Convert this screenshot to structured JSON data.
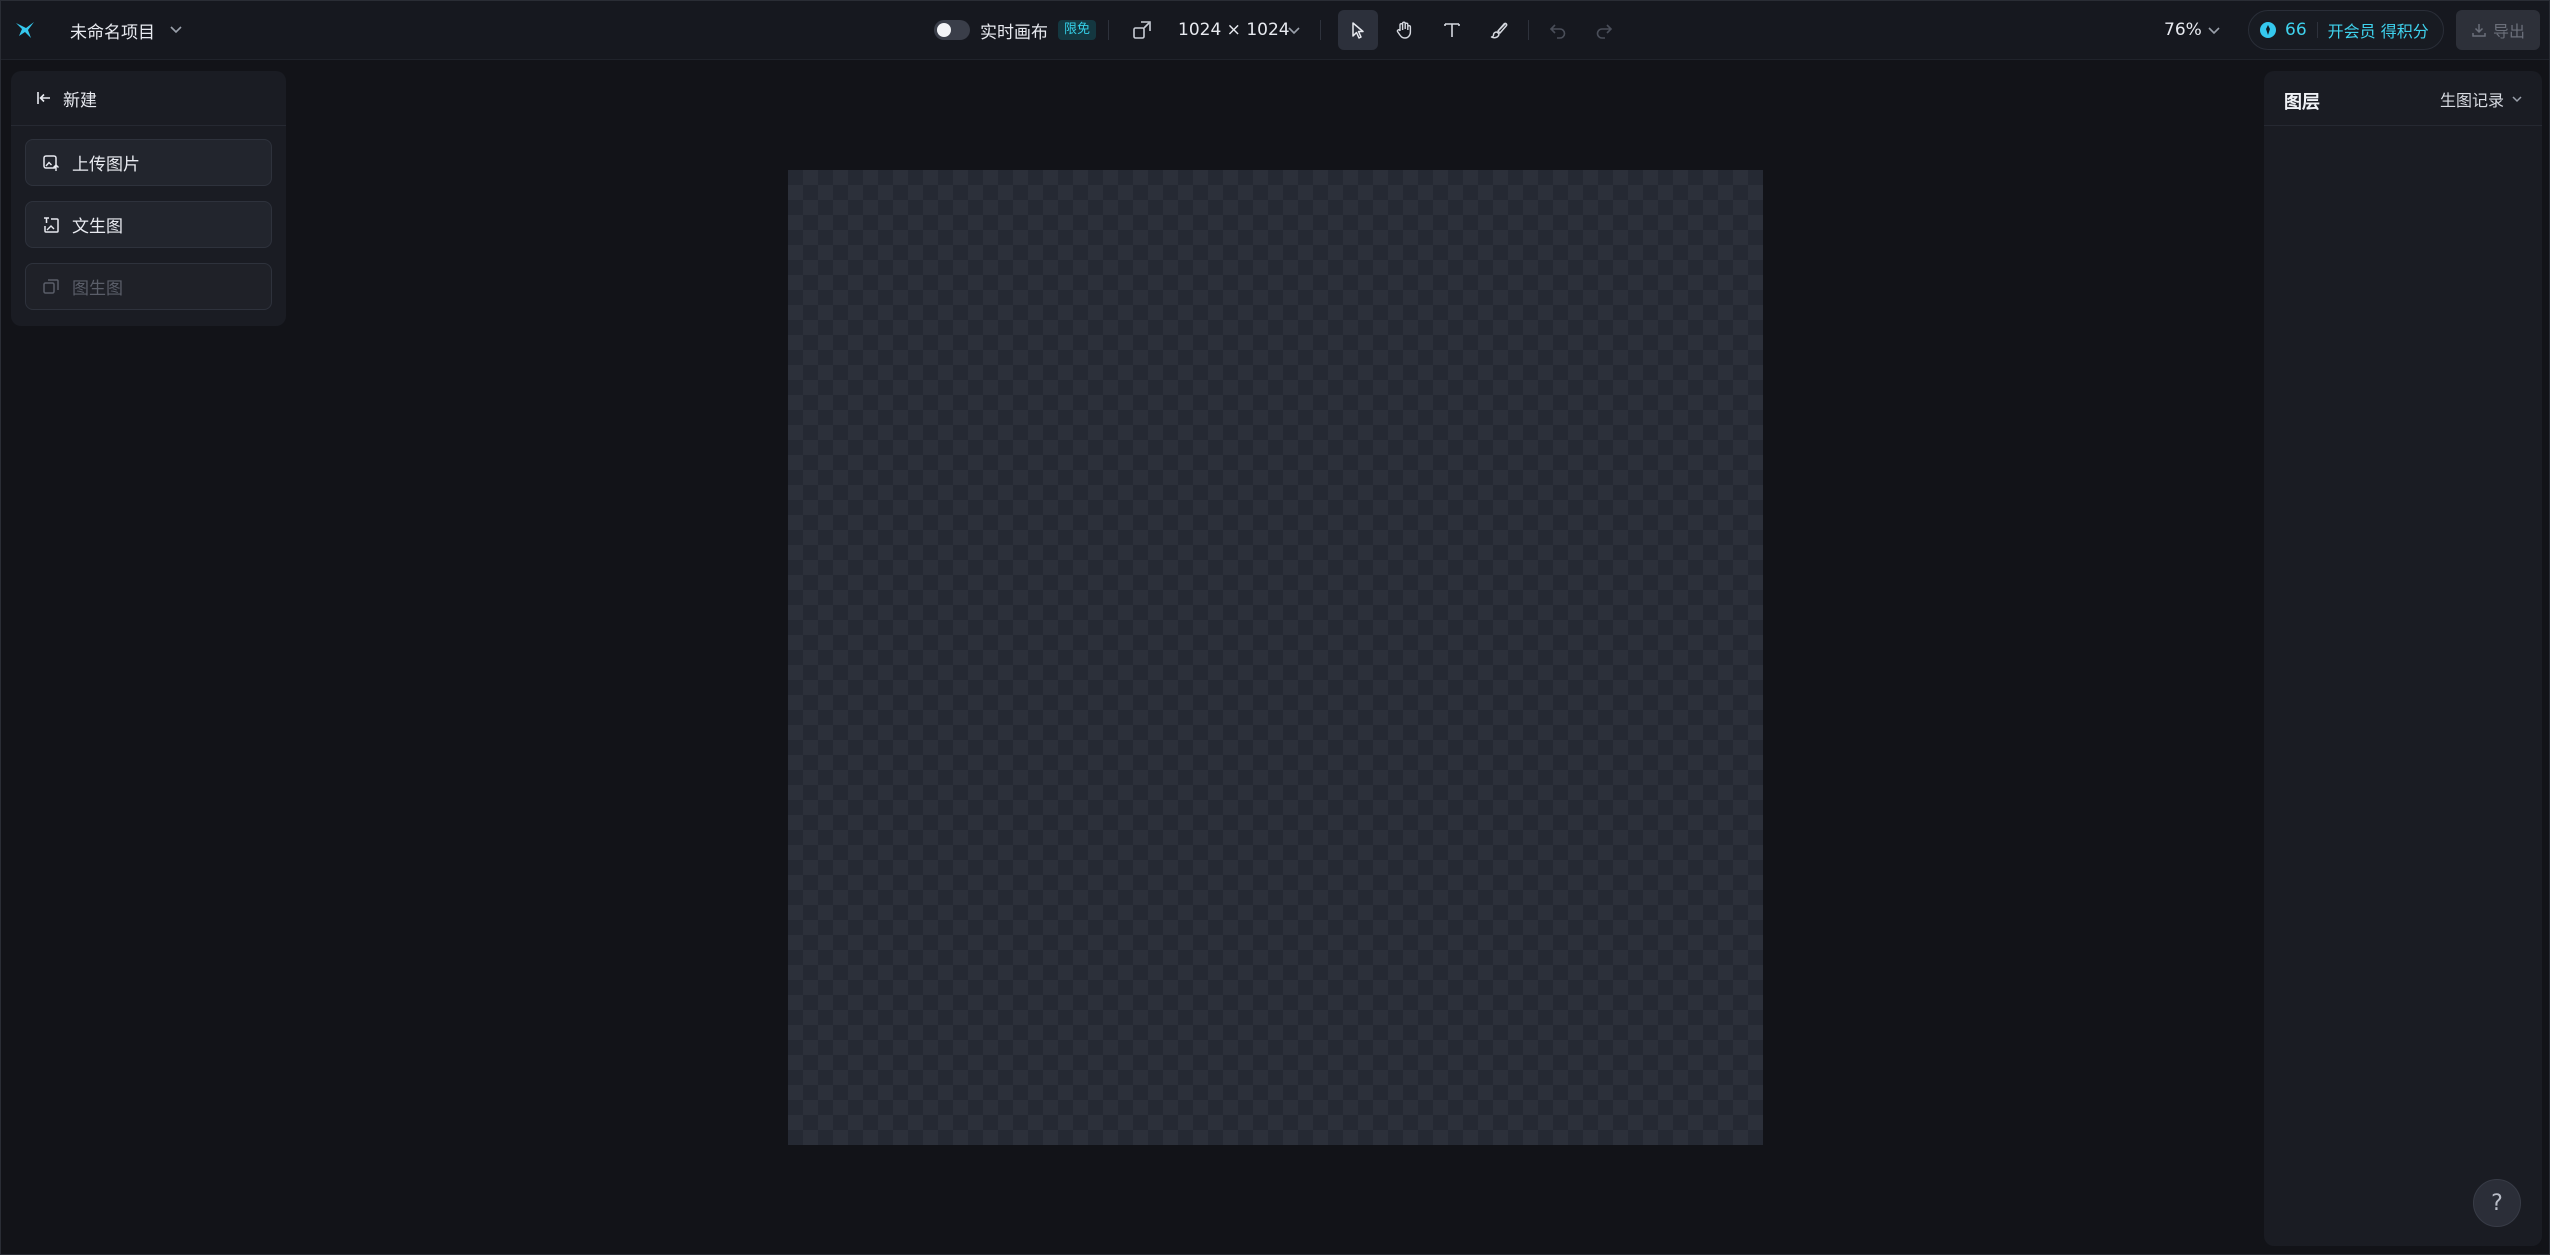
{
  "topbar": {
    "logo_icon": "brand-bird-icon",
    "project_title": "未命名项目",
    "realtime_canvas_label": "实时画布",
    "realtime_badge": "限免",
    "canvas_size": "1024 × 1024",
    "zoom_level": "76%",
    "credits": {
      "count": "66",
      "cta": "开会员 得积分"
    },
    "export_label": "导出",
    "tools": [
      "select-tool",
      "hand-tool",
      "text-tool",
      "brush-tool",
      "undo",
      "redo"
    ]
  },
  "left_panel": {
    "back_label": "新建",
    "buttons": [
      {
        "label": "上传图片",
        "icon": "upload-image-icon",
        "enabled": true
      },
      {
        "label": "文生图",
        "icon": "text-to-image-icon",
        "enabled": true
      },
      {
        "label": "图生图",
        "icon": "image-to-image-icon",
        "enabled": false
      }
    ]
  },
  "right_panel": {
    "title": "图层",
    "history_label": "生图记录"
  },
  "help": {
    "label": "?"
  },
  "colors": {
    "background": "#121318",
    "panel": "#1a1c23",
    "accent": "#3fd3ee"
  }
}
